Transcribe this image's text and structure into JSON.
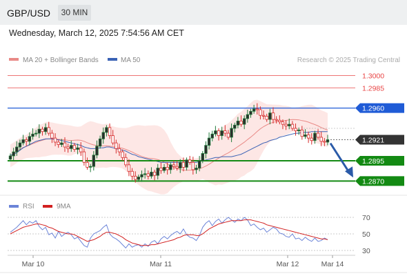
{
  "header": {
    "symbol": "GBP/USD",
    "timeframe": "30 MIN",
    "datetime": "Wednesday, March 12, 2025 7:54:56 AM CET"
  },
  "colors": {
    "bull": "#1f7a3a",
    "bear": "#d62b2b",
    "candle_bull_body": "#2b2b2b",
    "candle_bear_body": "#ffffff",
    "ma20": "#e98a87",
    "ma50": "#3a62b5",
    "band_fill": "#fde3e1",
    "resistance": "#e84545",
    "pivot_blue": "#1f5bd6",
    "support": "#138a13",
    "price_tag": "#333333",
    "arrow": "#2a5aa8",
    "rsi": "#6b84d8",
    "rsi_ma": "#d22020"
  },
  "chart_data": [
    {
      "type": "candlestick",
      "title": "",
      "legend": [
        {
          "name": "MA 20 + Bollinger Bands",
          "color": "#e98a87"
        },
        {
          "name": "MA 50",
          "color": "#3a62b5"
        }
      ],
      "legend_placement": "top-left",
      "watermark": "Research © 2025 Trading Central",
      "x_ticks": [
        "Mar 10",
        "Mar 11",
        "Mar 12",
        "Mar 14"
      ],
      "y_range": [
        1.2855,
        1.3015
      ],
      "current_price": "1.2921",
      "levels": [
        {
          "value": 1.3,
          "label": "1.3000",
          "kind": "resistance",
          "style": "thin"
        },
        {
          "value": 1.2985,
          "label": "1.2985",
          "kind": "resistance",
          "style": "thin"
        },
        {
          "value": 1.296,
          "label": "1.2960",
          "kind": "pivot",
          "style": "tag"
        },
        {
          "value": 1.2895,
          "label": "1.2895",
          "kind": "support",
          "style": "tag"
        },
        {
          "value": 1.287,
          "label": "1.2870",
          "kind": "support",
          "style": "tag"
        }
      ],
      "forecast_arrow": {
        "from": 1.292,
        "to": 1.2871,
        "direction": "down"
      },
      "close_series": [
        1.2901,
        1.2906,
        1.2912,
        1.2917,
        1.2921,
        1.2919,
        1.2925,
        1.2928,
        1.2929,
        1.2934,
        1.2931,
        1.2936,
        1.2929,
        1.2923,
        1.2918,
        1.2915,
        1.2917,
        1.2912,
        1.291,
        1.2914,
        1.2909,
        1.2911,
        1.2906,
        1.2893,
        1.2887,
        1.2888,
        1.2902,
        1.2913,
        1.2922,
        1.293,
        1.2936,
        1.2926,
        1.2917,
        1.291,
        1.2906,
        1.2899,
        1.289,
        1.2882,
        1.2876,
        1.2872,
        1.2875,
        1.2878,
        1.2879,
        1.2876,
        1.2881,
        1.2877,
        1.2886,
        1.2883,
        1.2887,
        1.2884,
        1.289,
        1.2888,
        1.2886,
        1.2893,
        1.2887,
        1.2896,
        1.2893,
        1.2884,
        1.2886,
        1.2895,
        1.2904,
        1.2914,
        1.2923,
        1.2928,
        1.2932,
        1.2926,
        1.2932,
        1.2929,
        1.2924,
        1.2935,
        1.2939,
        1.2944,
        1.294,
        1.2947,
        1.2952,
        1.2956,
        1.2959,
        1.2958,
        1.2951,
        1.295,
        1.2946,
        1.2954,
        1.2946,
        1.2945,
        1.2943,
        1.294,
        1.2938,
        1.294,
        1.2935,
        1.2932,
        1.2933,
        1.2925,
        1.2927,
        1.2923,
        1.292,
        1.2929,
        1.2924,
        1.2919,
        1.2918,
        1.2921
      ],
      "ma50_series": [
        1.2902,
        1.2903,
        1.2905,
        1.2908,
        1.2911,
        1.2913,
        1.2915,
        1.2917,
        1.2919,
        1.292,
        1.2921,
        1.2922,
        1.2922,
        1.2922,
        1.2921,
        1.2921,
        1.292,
        1.2919,
        1.2918,
        1.2917,
        1.2916,
        1.2915,
        1.2914,
        1.2912,
        1.2911,
        1.291,
        1.291,
        1.291,
        1.2911,
        1.2911,
        1.2912,
        1.2912,
        1.2911,
        1.291,
        1.2909,
        1.2908,
        1.2907,
        1.2905,
        1.2903,
        1.2902,
        1.29,
        1.2899,
        1.2898,
        1.2897,
        1.2896,
        1.2895,
        1.2894,
        1.2893,
        1.2893,
        1.2893,
        1.2893,
        1.2893,
        1.2893,
        1.2893,
        1.2893,
        1.2893,
        1.2893,
        1.2893,
        1.2893,
        1.2894,
        1.2895,
        1.2896,
        1.2897,
        1.2898,
        1.2899,
        1.2899,
        1.29,
        1.29,
        1.29,
        1.29,
        1.2901,
        1.2902,
        1.2903,
        1.2905,
        1.2907,
        1.2909,
        1.2911,
        1.2913,
        1.2915,
        1.2917,
        1.2918,
        1.292,
        1.2921,
        1.2922,
        1.2924,
        1.2925,
        1.2926,
        1.2927,
        1.2928,
        1.2929,
        1.2929,
        1.293,
        1.293,
        1.293,
        1.2931,
        1.2931,
        1.2931,
        1.2931,
        1.2931,
        1.2931
      ]
    },
    {
      "type": "line",
      "title": "",
      "legend": [
        {
          "name": "RSI",
          "color": "#6b84d8"
        },
        {
          "name": "9MA",
          "color": "#d22020"
        }
      ],
      "legend_placement": "top-left",
      "y_ticks": [
        70,
        50,
        30
      ],
      "y_range": [
        20,
        80
      ],
      "series": [
        {
          "name": "RSI",
          "values": [
            52,
            55,
            58,
            62,
            66,
            61,
            65,
            63,
            66,
            59,
            55,
            58,
            49,
            51,
            45,
            53,
            47,
            50,
            52,
            49,
            44,
            46,
            41,
            36,
            34,
            45,
            50,
            52,
            54,
            58,
            61,
            50,
            46,
            44,
            41,
            37,
            33,
            38,
            34,
            36,
            37,
            34,
            38,
            35,
            40,
            42,
            38,
            44,
            47,
            44,
            48,
            51,
            53,
            50,
            56,
            49,
            46,
            45,
            42,
            48,
            58,
            63,
            66,
            60,
            65,
            68,
            63,
            67,
            70,
            67,
            64,
            68,
            66,
            70,
            67,
            60,
            62,
            58,
            55,
            57,
            52,
            55,
            58,
            56,
            51,
            50,
            47,
            46,
            50,
            44,
            45,
            42,
            46,
            43,
            41,
            45,
            41,
            42,
            45,
            43
          ]
        },
        {
          "name": "9MA",
          "values": [
            50,
            52,
            54,
            56,
            58,
            59,
            60,
            61,
            62,
            62,
            61,
            60,
            58,
            57,
            55,
            53,
            52,
            51,
            50,
            50,
            49,
            47,
            45,
            43,
            41,
            42,
            43,
            45,
            47,
            50,
            52,
            52,
            51,
            50,
            48,
            46,
            43,
            41,
            39,
            38,
            37,
            36,
            36,
            36,
            37,
            37,
            38,
            39,
            40,
            41,
            42,
            43,
            45,
            46,
            48,
            49,
            49,
            49,
            48,
            48,
            50,
            53,
            56,
            58,
            60,
            62,
            63,
            64,
            65,
            66,
            66,
            66,
            66,
            67,
            67,
            67,
            66,
            65,
            64,
            63,
            61,
            60,
            59,
            58,
            57,
            56,
            55,
            54,
            53,
            52,
            51,
            50,
            49,
            48,
            47,
            46,
            45,
            44,
            44,
            43
          ]
        }
      ],
      "x_ticks": [
        "Mar 10",
        "Mar 11",
        "Mar 12",
        "Mar 14"
      ]
    }
  ]
}
